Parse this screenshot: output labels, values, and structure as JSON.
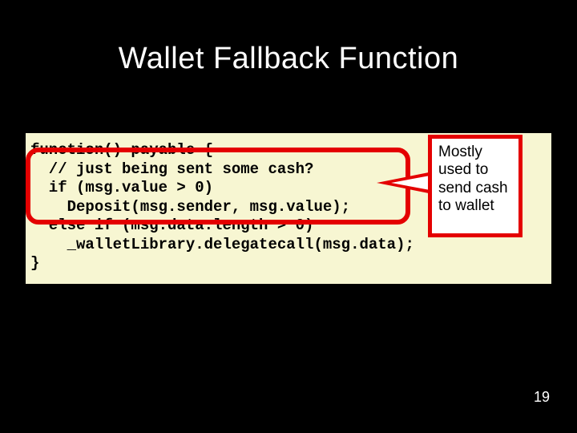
{
  "title": "Wallet Fallback Function",
  "code": {
    "l1": "function() payable {",
    "l2": "  // just being sent some cash?",
    "l3": "  if (msg.value > 0)",
    "l4": "    Deposit(msg.sender, msg.value);",
    "l5": "  else if (msg.data.length > 0)",
    "l6": "    _walletLibrary.delegatecall(msg.data);",
    "l7": "}"
  },
  "callout": "Mostly used to send cash to wallet",
  "page_number": "19"
}
